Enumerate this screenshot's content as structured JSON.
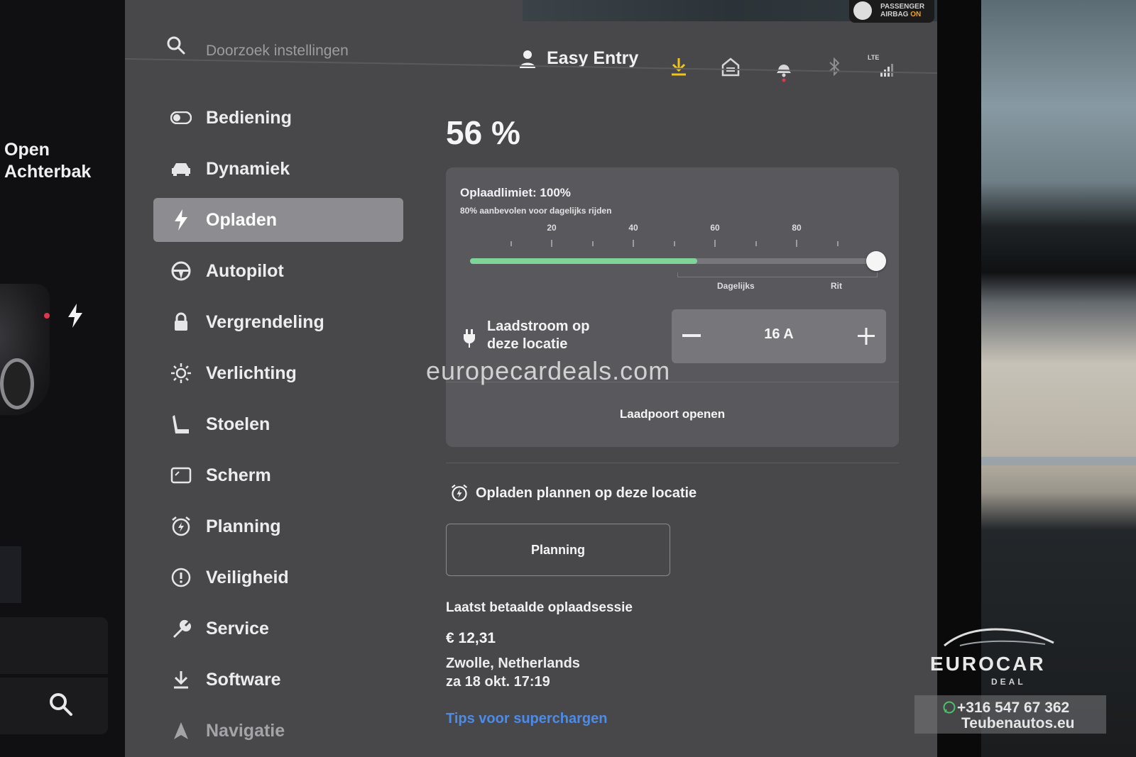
{
  "car_panel": {
    "trunk_label_line1": "Open",
    "trunk_label_line2": "Achterbak"
  },
  "header": {
    "search_placeholder": "Doorzoek instellingen",
    "profile_name": "Easy Entry",
    "airbag_line1": "PASSENGER",
    "airbag_line2": "AIRBAG",
    "airbag_status": "ON",
    "lte_label": "LTE"
  },
  "sidebar": {
    "items": [
      {
        "label": "Bediening",
        "icon": "toggle-icon"
      },
      {
        "label": "Dynamiek",
        "icon": "car-icon"
      },
      {
        "label": "Opladen",
        "icon": "bolt-icon",
        "active": true
      },
      {
        "label": "Autopilot",
        "icon": "steering-wheel-icon"
      },
      {
        "label": "Vergrendeling",
        "icon": "lock-icon"
      },
      {
        "label": "Verlichting",
        "icon": "sun-icon"
      },
      {
        "label": "Stoelen",
        "icon": "seat-icon"
      },
      {
        "label": "Scherm",
        "icon": "display-icon"
      },
      {
        "label": "Planning",
        "icon": "alarm-clock-icon"
      },
      {
        "label": "Veiligheid",
        "icon": "alert-circle-icon"
      },
      {
        "label": "Service",
        "icon": "wrench-icon"
      },
      {
        "label": "Software",
        "icon": "download-icon"
      },
      {
        "label": "Navigatie",
        "icon": "navigation-icon"
      }
    ]
  },
  "charging": {
    "battery_percent": "56 %",
    "limit_title": "Oplaadlimiet: 100%",
    "limit_subtitle": "80% aanbevolen voor dagelijks rijden",
    "limit_value": 100,
    "current_charge_value": 56,
    "tick_labels": [
      "20",
      "40",
      "60",
      "80"
    ],
    "range_daily": "Dagelijks",
    "range_trip": "Rit",
    "current_label_line1": "Laadstroom op",
    "current_label_line2": "deze locatie",
    "current_value": "16 A",
    "open_port_label": "Laadpoort openen",
    "schedule_label": "Opladen plannen op deze locatie",
    "planning_button": "Planning",
    "last_session_title": "Laatst betaalde oplaadsessie",
    "last_session_price": "€ 12,31",
    "last_session_location": "Zwolle, Netherlands",
    "last_session_time": "za 18 okt. 17:19",
    "tips_link": "Tips voor superchargen"
  },
  "overlay": {
    "watermark": "europecardeals.com",
    "logo_name": "EUROCAR",
    "logo_sub": "DEAL",
    "phone": "+316 547 67 362",
    "site": "Teubenautos.eu"
  },
  "colors": {
    "accent_green": "#7fd49a",
    "download_yellow": "#f0c419",
    "link_blue": "#4c8be8",
    "alert_red": "#e0364a"
  }
}
